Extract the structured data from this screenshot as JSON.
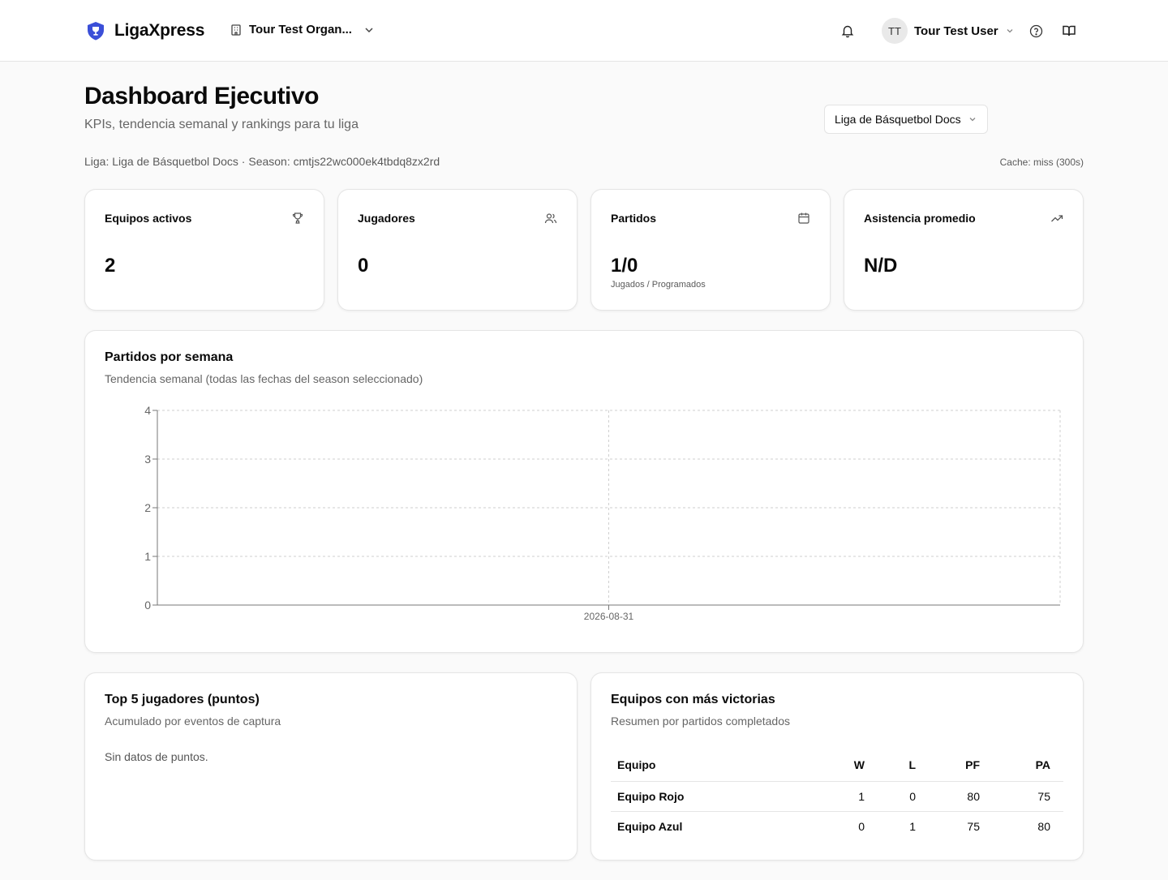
{
  "header": {
    "brand": "LigaXpress",
    "org_name": "Tour Test Organ...",
    "user_initials": "TT",
    "user_name": "Tour Test User",
    "accent_color": "#3b4fd8"
  },
  "page": {
    "title": "Dashboard Ejecutivo",
    "subtitle": "KPIs, tendencia semanal y rankings para tu liga",
    "league_selector": "Liga de Básquetbol Docs",
    "meta": "Liga: Liga de Básquetbol Docs · Season: cmtjs22wc000ek4tbdq8zx2rd",
    "cache": "Cache: miss (300s)"
  },
  "kpis": [
    {
      "title": "Equipos activos",
      "value": "2",
      "icon": "trophy-icon"
    },
    {
      "title": "Jugadores",
      "value": "0",
      "icon": "users-icon"
    },
    {
      "title": "Partidos",
      "value": "1/0",
      "note": "Jugados / Programados",
      "icon": "calendar-icon"
    },
    {
      "title": "Asistencia promedio",
      "value": "N/D",
      "icon": "trending-up-icon"
    }
  ],
  "weekly": {
    "title": "Partidos por semana",
    "subtitle": "Tendencia semanal (todas las fechas del season seleccionado)"
  },
  "chart_data": {
    "type": "line",
    "x": [
      "2026-08-31"
    ],
    "series": [
      {
        "values": [
          0
        ]
      }
    ],
    "ylim": [
      0,
      4
    ],
    "yticks": [
      0,
      1,
      2,
      3,
      4
    ],
    "grid": true,
    "title": "",
    "xlabel": "",
    "ylabel": ""
  },
  "top_players": {
    "title": "Top 5 jugadores (puntos)",
    "subtitle": "Acumulado por eventos de captura",
    "empty": "Sin datos de puntos."
  },
  "top_teams": {
    "title": "Equipos con más victorias",
    "subtitle": "Resumen por partidos completados",
    "columns": [
      "Equipo",
      "W",
      "L",
      "PF",
      "PA"
    ],
    "rows": [
      [
        "Equipo Rojo",
        "1",
        "0",
        "80",
        "75"
      ],
      [
        "Equipo Azul",
        "0",
        "1",
        "75",
        "80"
      ]
    ]
  }
}
